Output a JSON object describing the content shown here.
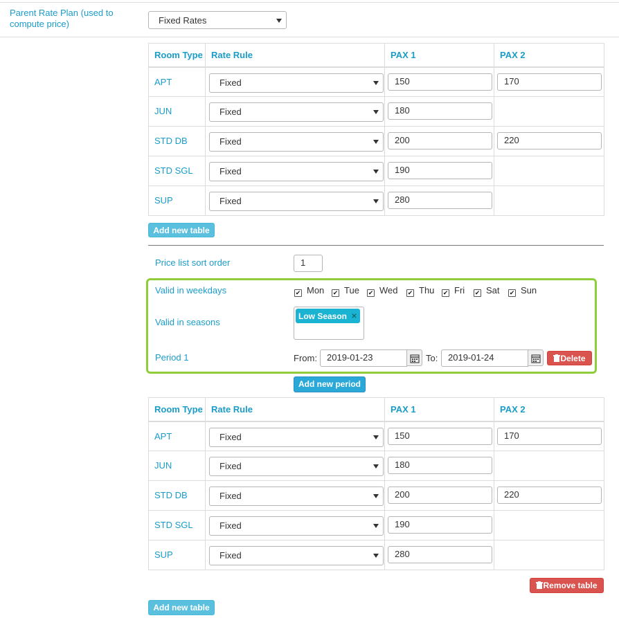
{
  "parent_rate_plan": {
    "label_line1": "Parent Rate Plan (used to",
    "label_line2": "compute price)",
    "selected": "Fixed Rates"
  },
  "table_headers": {
    "room_type": "Room Type",
    "rate_rule": "Rate Rule",
    "pax1": "PAX 1",
    "pax2": "PAX 2"
  },
  "table1": {
    "rows": [
      {
        "room": "APT",
        "rule": "Fixed",
        "pax1": "150",
        "pax2": "170"
      },
      {
        "room": "JUN",
        "rule": "Fixed",
        "pax1": "180",
        "pax2": ""
      },
      {
        "room": "STD DB",
        "rule": "Fixed",
        "pax1": "200",
        "pax2": "220"
      },
      {
        "room": "STD SGL",
        "rule": "Fixed",
        "pax1": "190",
        "pax2": ""
      },
      {
        "room": "SUP",
        "rule": "Fixed",
        "pax1": "280",
        "pax2": ""
      }
    ]
  },
  "add_new_table_label": "Add new table",
  "price_list": {
    "sort_order_label": "Price list sort order",
    "sort_order_value": "1",
    "weekdays_label": "Valid in weekdays",
    "weekdays": [
      "Mon",
      "Tue",
      "Wed",
      "Thu",
      "Fri",
      "Sat",
      "Sun"
    ],
    "seasons_label": "Valid in seasons",
    "season_tag": "Low Season",
    "season_tag_remove": "×",
    "period_label": "Period 1",
    "from_label": "From:",
    "from_value": "2019-01-23",
    "to_label": "To:",
    "to_value": "2019-01-24",
    "delete_label": "Delete",
    "add_period_label": "Add new period"
  },
  "table2": {
    "rows": [
      {
        "room": "APT",
        "rule": "Fixed",
        "pax1": "150",
        "pax2": "170"
      },
      {
        "room": "JUN",
        "rule": "Fixed",
        "pax1": "180",
        "pax2": ""
      },
      {
        "room": "STD DB",
        "rule": "Fixed",
        "pax1": "200",
        "pax2": "220"
      },
      {
        "room": "STD SGL",
        "rule": "Fixed",
        "pax1": "190",
        "pax2": ""
      },
      {
        "room": "SUP",
        "rule": "Fixed",
        "pax1": "280",
        "pax2": ""
      }
    ]
  },
  "remove_table_label": "Remove table",
  "colors": {
    "label": "#1a9cc9",
    "highlight": "#8fce3a",
    "danger": "#d9534f",
    "info": "#5bc0de"
  }
}
